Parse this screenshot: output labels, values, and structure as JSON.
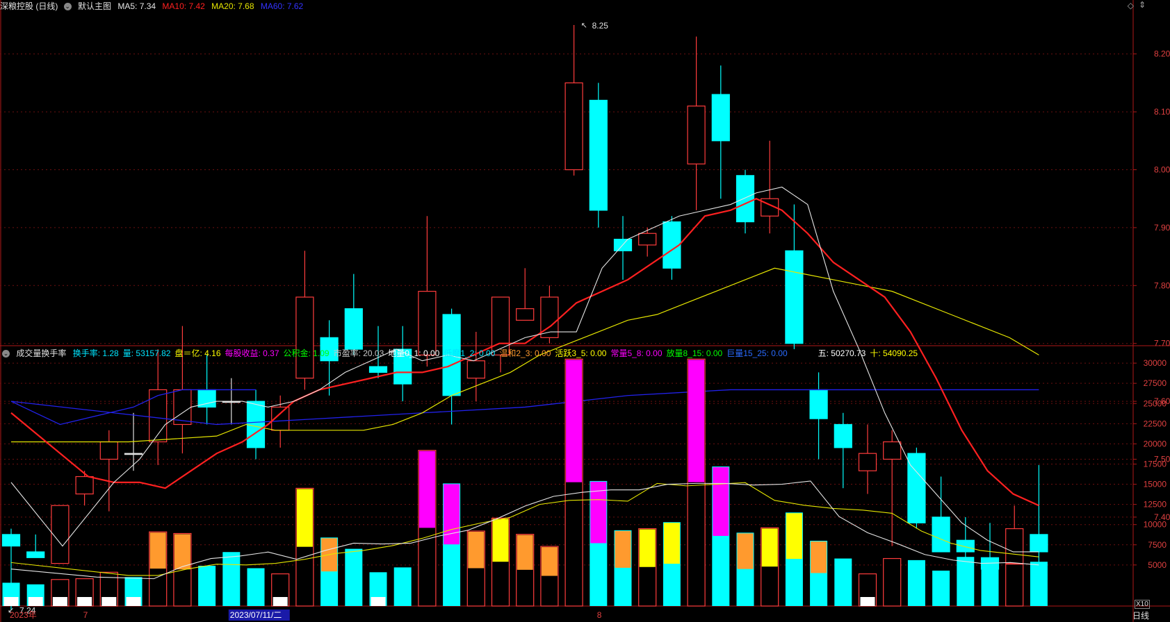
{
  "header": {
    "stock": "深粮控股 (日线)",
    "main_label": "默认主图",
    "ma5": "MA5: 7.34",
    "ma10": "MA10: 7.42",
    "ma20": "MA20: 7.68",
    "ma60": "MA60: 7.62"
  },
  "sub_header": {
    "title": "成交量换手率",
    "items": [
      {
        "text": "换手率: 1.28",
        "color": "#00e5ff"
      },
      {
        "text": "量: 53157.82",
        "color": "#00e5ff"
      },
      {
        "text": "盘＝亿: 4.16",
        "color": "#ffff00"
      },
      {
        "text": "每股收益: 0.37",
        "color": "#ff00ff"
      },
      {
        "text": "公积金: 1.09",
        "color": "#00ff00"
      },
      {
        "text": "市盈率: 20.03",
        "color": "#c8c8c8"
      },
      {
        "text": "地量0_1: 0.00",
        "color": "#ffffff"
      },
      {
        "text": "低靡1_2: 0.00",
        "color": "#00e5ff"
      },
      {
        "text": "温和2_3: 0.00",
        "color": "#ff9a2e"
      },
      {
        "text": "活跃3_5: 0.00",
        "color": "#ffff00"
      },
      {
        "text": "常量5_8: 0.00",
        "color": "#ff00ff"
      },
      {
        "text": "放量8_15: 0.00",
        "color": "#00ff00"
      },
      {
        "text": "巨量15_25: 0.00",
        "color": "#2a6bff"
      },
      {
        "text": "五: 50270.73",
        "color": "#ffffff"
      },
      {
        "text": "十: 54090.25",
        "color": "#ffff00"
      }
    ]
  },
  "bottom": {
    "dates": [
      {
        "text": "2023年",
        "i": 0
      },
      {
        "text": "7",
        "i": 3
      },
      {
        "text": "2023/07/11/二",
        "i": 9
      },
      {
        "text": "8",
        "i": 24
      }
    ],
    "period": "日线",
    "x10": "X10"
  },
  "annotations": {
    "high": "8.25",
    "low": "7.24"
  },
  "colors": {
    "up": "#ff3c3c",
    "down": "#00ffff",
    "ma5": "#e6e6e6",
    "ma10": "#ff2020",
    "ma20": "#e6e600",
    "ma60": "#2222ee",
    "grid": "#6e1010",
    "axis": "#b01818"
  },
  "chart_data": [
    {
      "type": "candlestick",
      "title": "深粮控股 (日线)",
      "ylim": [
        7.19,
        8.26
      ],
      "yticks": [
        7.4,
        7.5,
        7.6,
        7.7,
        7.8,
        7.9,
        8.0,
        8.1,
        8.2
      ],
      "yticklabels": [
        "7.40",
        "7.50",
        "7.60",
        "7.70",
        "7.80",
        "7.90",
        "8.00",
        "8.10",
        "8.20"
      ],
      "ohlc": [
        [
          7.37,
          7.38,
          7.24,
          7.35
        ],
        [
          7.34,
          7.37,
          7.33,
          7.33
        ],
        [
          7.32,
          7.42,
          7.32,
          7.42
        ],
        [
          7.44,
          7.48,
          7.42,
          7.47
        ],
        [
          7.5,
          7.55,
          7.41,
          7.53
        ],
        [
          7.51,
          7.58,
          7.48,
          7.51
        ],
        [
          7.53,
          7.69,
          7.49,
          7.62
        ],
        [
          7.56,
          7.73,
          7.51,
          7.62
        ],
        [
          7.62,
          7.68,
          7.56,
          7.59
        ],
        [
          7.6,
          7.64,
          7.56,
          7.6
        ],
        [
          7.6,
          7.62,
          7.5,
          7.52
        ],
        [
          7.55,
          7.61,
          7.52,
          7.59
        ],
        [
          7.64,
          7.86,
          7.62,
          7.78
        ],
        [
          7.71,
          7.74,
          7.61,
          7.67
        ],
        [
          7.76,
          7.82,
          7.68,
          7.69
        ],
        [
          7.66,
          7.73,
          7.64,
          7.65
        ],
        [
          7.69,
          7.73,
          7.6,
          7.63
        ],
        [
          7.68,
          7.92,
          7.66,
          7.79
        ],
        [
          7.75,
          7.76,
          7.56,
          7.61
        ],
        [
          7.64,
          7.72,
          7.6,
          7.67
        ],
        [
          7.68,
          7.78,
          7.65,
          7.78
        ],
        [
          7.74,
          7.83,
          7.74,
          7.76
        ],
        [
          7.71,
          7.8,
          7.7,
          7.78
        ],
        [
          8.0,
          8.25,
          7.99,
          8.15
        ],
        [
          8.12,
          8.15,
          7.9,
          7.93
        ],
        [
          7.88,
          7.92,
          7.81,
          7.86
        ],
        [
          7.87,
          7.9,
          7.85,
          7.89
        ],
        [
          7.91,
          7.92,
          7.81,
          7.83
        ],
        [
          8.01,
          8.23,
          7.93,
          8.11
        ],
        [
          8.13,
          8.18,
          7.95,
          8.05
        ],
        [
          7.99,
          8.0,
          7.89,
          7.91
        ],
        [
          7.92,
          8.05,
          7.89,
          7.95
        ],
        [
          7.86,
          7.94,
          7.69,
          7.7
        ],
        [
          7.62,
          7.65,
          7.5,
          7.57
        ],
        [
          7.56,
          7.58,
          7.45,
          7.52
        ],
        [
          7.48,
          7.56,
          7.44,
          7.51
        ],
        [
          7.5,
          7.55,
          7.35,
          7.53
        ],
        [
          7.51,
          7.52,
          7.38,
          7.39
        ],
        [
          7.4,
          7.47,
          7.34,
          7.34
        ],
        [
          7.36,
          7.4,
          7.27,
          7.34
        ],
        [
          7.33,
          7.39,
          7.29,
          7.31
        ],
        [
          7.32,
          7.42,
          7.27,
          7.38
        ],
        [
          7.37,
          7.49,
          7.32,
          7.34
        ]
      ],
      "ma5": [
        7.46,
        null,
        7.35,
        null,
        7.46,
        7.5,
        7.56,
        7.59,
        7.6,
        7.6,
        7.59,
        7.6,
        7.62,
        7.65,
        7.67,
        7.69,
        7.67,
        7.68,
        7.67,
        7.69,
        7.71,
        7.72,
        7.72,
        7.83,
        7.88,
        7.9,
        7.92,
        7.93,
        7.94,
        7.96,
        7.97,
        7.94,
        7.79,
        7.69,
        7.58,
        7.49,
        7.44,
        7.39,
        7.36,
        7.34,
        7.34
      ],
      "ma10": [
        7.58,
        null,
        null,
        7.47,
        7.46,
        7.46,
        7.45,
        7.48,
        7.51,
        7.53,
        7.56,
        7.6,
        7.62,
        7.63,
        7.64,
        7.65,
        7.65,
        7.66,
        7.68,
        7.7,
        7.7,
        7.73,
        7.77,
        7.79,
        7.81,
        7.84,
        7.87,
        7.92,
        7.93,
        7.95,
        7.93,
        7.89,
        7.84,
        7.81,
        7.78,
        7.72,
        7.64,
        7.55,
        7.48,
        7.44,
        7.42
      ],
      "ma20": [
        7.53,
        null,
        null,
        null,
        7.53,
        null,
        null,
        7.54,
        7.56,
        7.55,
        null,
        7.55,
        7.55,
        7.56,
        7.58,
        7.61,
        7.63,
        7.65,
        7.68,
        7.7,
        7.72,
        7.74,
        7.75,
        7.77,
        7.79,
        7.81,
        7.83,
        7.82,
        7.81,
        7.8,
        7.79,
        7.77,
        7.75,
        7.73,
        7.71,
        7.68
      ],
      "ma60": [
        7.6,
        7.58,
        7.56,
        7.57,
        7.58,
        7.59,
        7.61,
        7.62,
        7.62,
        7.62,
        7.62
      ]
    },
    {
      "type": "bar",
      "title": "成交量换手率",
      "ylim": [
        0,
        30600
      ],
      "yticks": [
        5000,
        7500,
        10000,
        12500,
        15000,
        17500,
        20000,
        22500,
        25000,
        27500,
        30000
      ],
      "yticklabels": [
        "5000",
        "7500",
        "10000",
        "12500",
        "15000",
        "17500",
        "20000",
        "22500",
        "25000",
        "27500",
        "30000"
      ],
      "volumes": [
        2800,
        2600,
        3200,
        3300,
        4100,
        3500,
        9100,
        8900,
        4900,
        6600,
        4600,
        3900,
        14500,
        8400,
        7000,
        4100,
        4700,
        19200,
        15100,
        9200,
        10800,
        8800,
        7300,
        30500,
        15400,
        9300,
        9500,
        10300,
        30500,
        17200,
        9000,
        9600,
        11500,
        8000,
        5800,
        3900,
        5800,
        5600,
        4300,
        6000,
        4600,
        5100,
        5400
      ],
      "ma5": [
        4500,
        null,
        null,
        3500,
        3400,
        3300,
        4800,
        5800,
        6100,
        6600,
        5700,
        6800,
        7700,
        7600,
        7700,
        8600,
        9300,
        10700,
        12300,
        13500,
        14000,
        14300,
        14300,
        15000,
        15100,
        15100,
        14900,
        15000,
        15400,
        11000,
        9000,
        7700,
        6300,
        5600,
        5200,
        5300,
        5000
      ],
      "ma10": [
        5300,
        null,
        null,
        4100,
        3700,
        3700,
        4500,
        5100,
        5000,
        5200,
        5700,
        6400,
        6800,
        7400,
        8300,
        9400,
        10200,
        10900,
        12500,
        13000,
        13100,
        12900,
        15100,
        14800,
        15000,
        15200,
        13000,
        12400,
        12000,
        11800,
        11400,
        9200,
        7700,
        6800,
        6400,
        6000
      ]
    }
  ]
}
